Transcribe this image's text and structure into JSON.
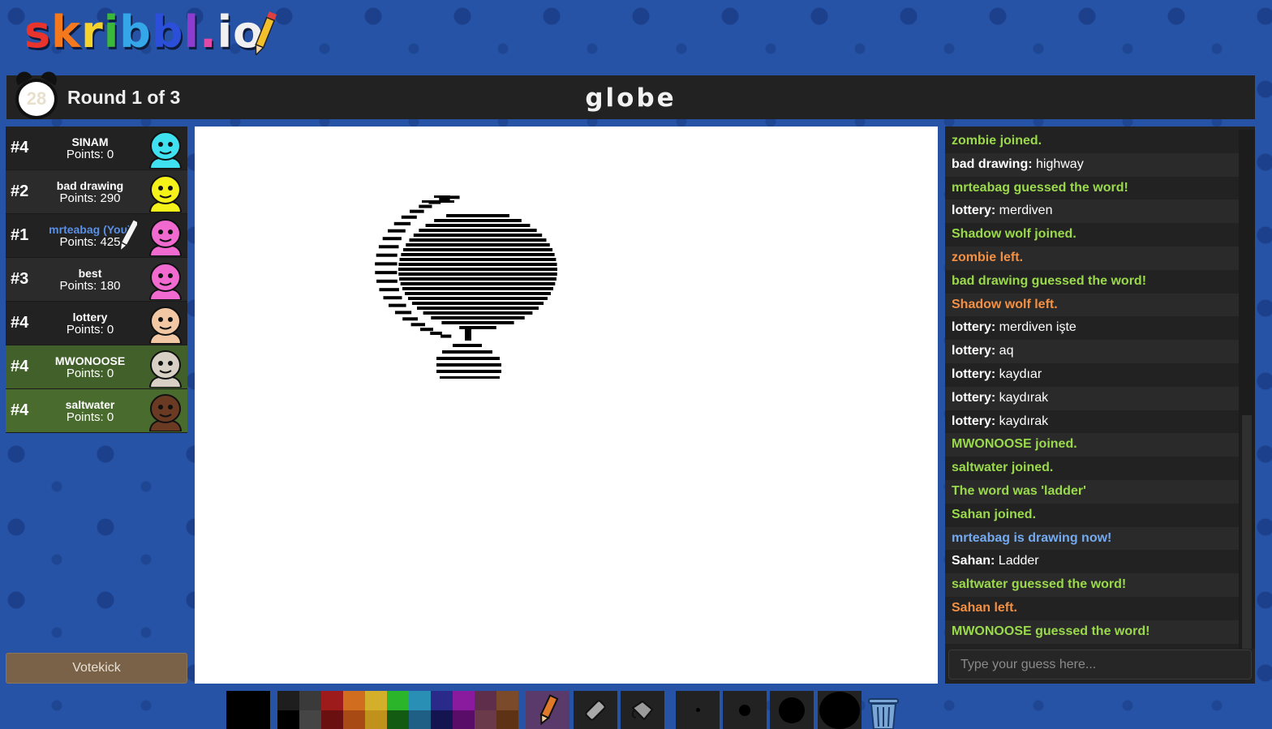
{
  "app": {
    "logo_letters": [
      "s",
      "k",
      "r",
      "i",
      "b",
      "b",
      "l",
      ".",
      "i",
      "o"
    ]
  },
  "header": {
    "timer": "28",
    "round_label": "Round 1 of 3",
    "word": "globe"
  },
  "players": [
    {
      "rank": "#4",
      "name": "SINAM",
      "points": "Points: 0",
      "avatar_color": "#3fe0f0",
      "guessed": false,
      "me": false,
      "drawing": false
    },
    {
      "rank": "#2",
      "name": "bad drawing",
      "points": "Points: 290",
      "avatar_color": "#f5f21a",
      "guessed": false,
      "me": false,
      "drawing": false
    },
    {
      "rank": "#1",
      "name": "mrteabag (You)",
      "points": "Points: 425",
      "avatar_color": "#f06ad0",
      "guessed": false,
      "me": true,
      "drawing": true
    },
    {
      "rank": "#3",
      "name": "best",
      "points": "Points: 180",
      "avatar_color": "#f06ad0",
      "guessed": false,
      "me": false,
      "drawing": false
    },
    {
      "rank": "#4",
      "name": "lottery",
      "points": "Points: 0",
      "avatar_color": "#f2c8a4",
      "guessed": false,
      "me": false,
      "drawing": false
    },
    {
      "rank": "#4",
      "name": "MWONOOSE",
      "points": "Points: 0",
      "avatar_color": "#d8d0c4",
      "guessed": true,
      "me": false,
      "drawing": false
    },
    {
      "rank": "#4",
      "name": "saltwater",
      "points": "Points: 0",
      "avatar_color": "#6a3a22",
      "guessed": true,
      "me": false,
      "drawing": false
    }
  ],
  "votekick": {
    "label": "Votekick"
  },
  "chat": {
    "messages": [
      {
        "kind": "green",
        "author": "",
        "text": "zombie joined."
      },
      {
        "kind": "chat",
        "author": "bad drawing: ",
        "text": "highway"
      },
      {
        "kind": "green",
        "author": "",
        "text": "mrteabag guessed the word!"
      },
      {
        "kind": "chat",
        "author": "lottery: ",
        "text": "merdiven"
      },
      {
        "kind": "green",
        "author": "",
        "text": "Shadow wolf joined."
      },
      {
        "kind": "orange",
        "author": "",
        "text": "zombie left."
      },
      {
        "kind": "green",
        "author": "",
        "text": "bad drawing guessed the word!"
      },
      {
        "kind": "orange",
        "author": "",
        "text": "Shadow wolf left."
      },
      {
        "kind": "chat",
        "author": "lottery: ",
        "text": "merdiven işte"
      },
      {
        "kind": "chat",
        "author": "lottery: ",
        "text": "aq"
      },
      {
        "kind": "chat",
        "author": "lottery: ",
        "text": "kaydıar"
      },
      {
        "kind": "chat",
        "author": "lottery: ",
        "text": "kaydırak"
      },
      {
        "kind": "chat",
        "author": "lottery: ",
        "text": "kaydırak"
      },
      {
        "kind": "green",
        "author": "",
        "text": "MWONOOSE joined."
      },
      {
        "kind": "green",
        "author": "",
        "text": "saltwater joined."
      },
      {
        "kind": "green",
        "author": "",
        "text": "The word was 'ladder'"
      },
      {
        "kind": "green",
        "author": "",
        "text": "Sahan joined."
      },
      {
        "kind": "blue",
        "author": "",
        "text": "mrteabag is drawing now!"
      },
      {
        "kind": "chat",
        "author": "Sahan: ",
        "text": "Ladder"
      },
      {
        "kind": "green",
        "author": "",
        "text": "saltwater guessed the word!"
      },
      {
        "kind": "orange",
        "author": "",
        "text": "Sahan left."
      },
      {
        "kind": "green",
        "author": "",
        "text": "MWONOOSE guessed the word!"
      }
    ],
    "input_placeholder": "Type your guess here..."
  },
  "toolbar": {
    "current_color": "#000000",
    "palette_top": [
      "#1e1e1e",
      "#3a3a3a",
      "#9e1b1b",
      "#d16d1e",
      "#d4b02a",
      "#2ab52a",
      "#2a8fb5",
      "#2a2a8a",
      "#8a1a9e",
      "#5e2e4a",
      "#7a4a2a"
    ],
    "palette_bottom": [
      "#000000",
      "#454545",
      "#6a1010",
      "#a84a14",
      "#c0921c",
      "#135a13",
      "#1f5f86",
      "#141450",
      "#5a0d68",
      "#6a3a4a",
      "#5e3214"
    ],
    "tools": [
      "pencil-icon",
      "eraser-icon",
      "fill-bucket-icon"
    ],
    "active_tool": "pencil-icon",
    "brush_sizes": [
      "small",
      "medium",
      "large",
      "xlarge"
    ]
  }
}
